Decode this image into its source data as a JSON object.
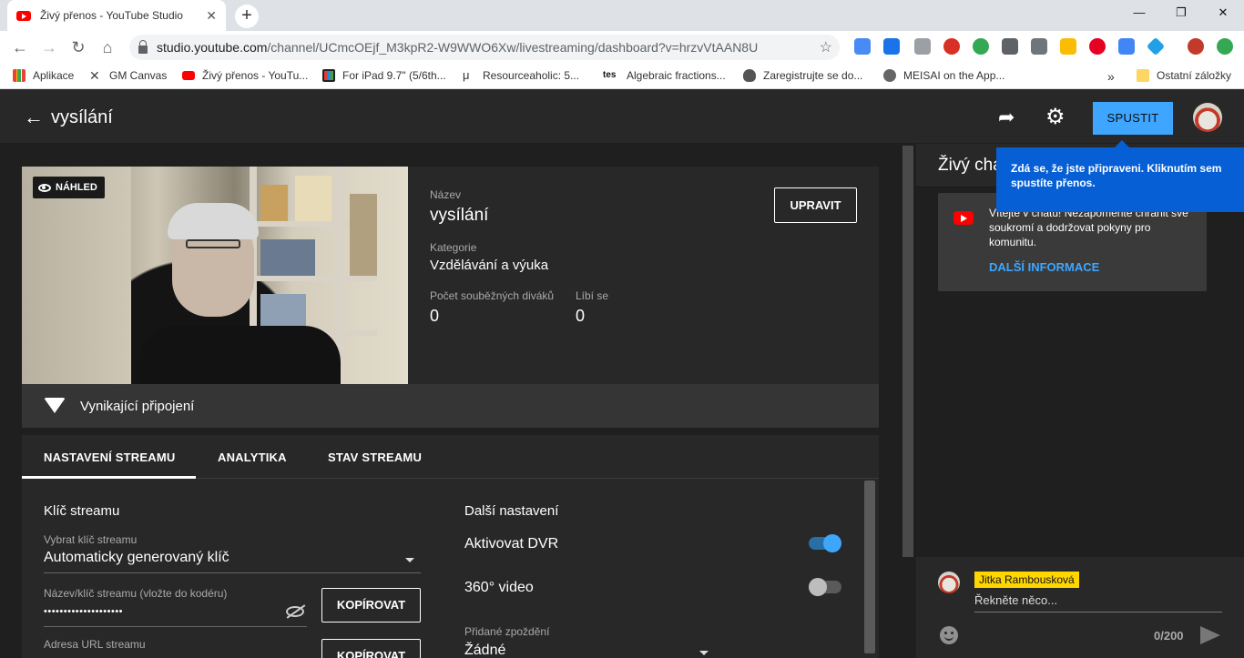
{
  "browser": {
    "tab_title": "Živý přenos - YouTube Studio",
    "tab_close": "✕",
    "new_tab": "+",
    "url_host": "studio.youtube.com",
    "url_path": "/channel/UCmcOEjf_M3kpR2-W9WWO6Xw/livestreaming/dashboard?v=hrzvVtAAN8U",
    "bookmarks": [
      "Aplikace",
      "GM Canvas",
      "Živý přenos - YouTu...",
      "For iPad 9.7\" (5/6th...",
      "Resourceaholic: 5...",
      "Algebraic fractions...",
      "Zaregistrujte se do...",
      "MEISAI on the App..."
    ],
    "bookmarks_overflow": "»",
    "other_bookmarks": "Ostatní záložky"
  },
  "header": {
    "title": "vysílání",
    "start_button": "SPUSTIT"
  },
  "preview": {
    "badge": "NÁHLED"
  },
  "stream_info": {
    "name_label": "Název",
    "name_value": "vysílání",
    "category_label": "Kategorie",
    "category_value": "Vzdělávání a výuka",
    "viewers_label": "Počet souběžných diváků",
    "viewers_value": "0",
    "likes_label": "Líbí se",
    "likes_value": "0",
    "edit_button": "UPRAVIT"
  },
  "connection": {
    "status": "Vynikající připojení"
  },
  "tabs": [
    "NASTAVENÍ STREAMU",
    "ANALYTIKA",
    "STAV STREAMU"
  ],
  "stream_key": {
    "heading": "Klíč streamu",
    "select_label": "Vybrat klíč streamu",
    "select_value": "Automaticky generovaný klíč",
    "key_label": "Název/klíč streamu (vložte do kodéru)",
    "key_value": "••••••••••••••••••••",
    "copy_button": "KOPÍROVAT",
    "url_label": "Adresa URL streamu",
    "copy_button_2": "KOPÍROVAT"
  },
  "other_settings": {
    "heading": "Další nastavení",
    "dvr_label": "Aktivovat DVR",
    "dvr_on": true,
    "video360_label": "360° video",
    "video360_on": false,
    "delay_label": "Přidané zpoždění",
    "delay_value": "Žádné"
  },
  "chat": {
    "title": "Živý chat",
    "tooltip": "Zdá se, že jste připraveni. Kliknutím sem spustíte přenos.",
    "welcome_text": "Vítejte v chatu! Nezapomeňte chránit své soukromí a dodržovat pokyny pro komunitu.",
    "more_info": "DALŠÍ INFORMACE",
    "user_name": "Jitka Rambousková",
    "input_placeholder": "Řekněte něco...",
    "counter": "0/200"
  },
  "colors": {
    "accent_blue": "#3ea6ff",
    "tooltip_blue": "#065fd4",
    "name_highlight": "#ffd600"
  }
}
